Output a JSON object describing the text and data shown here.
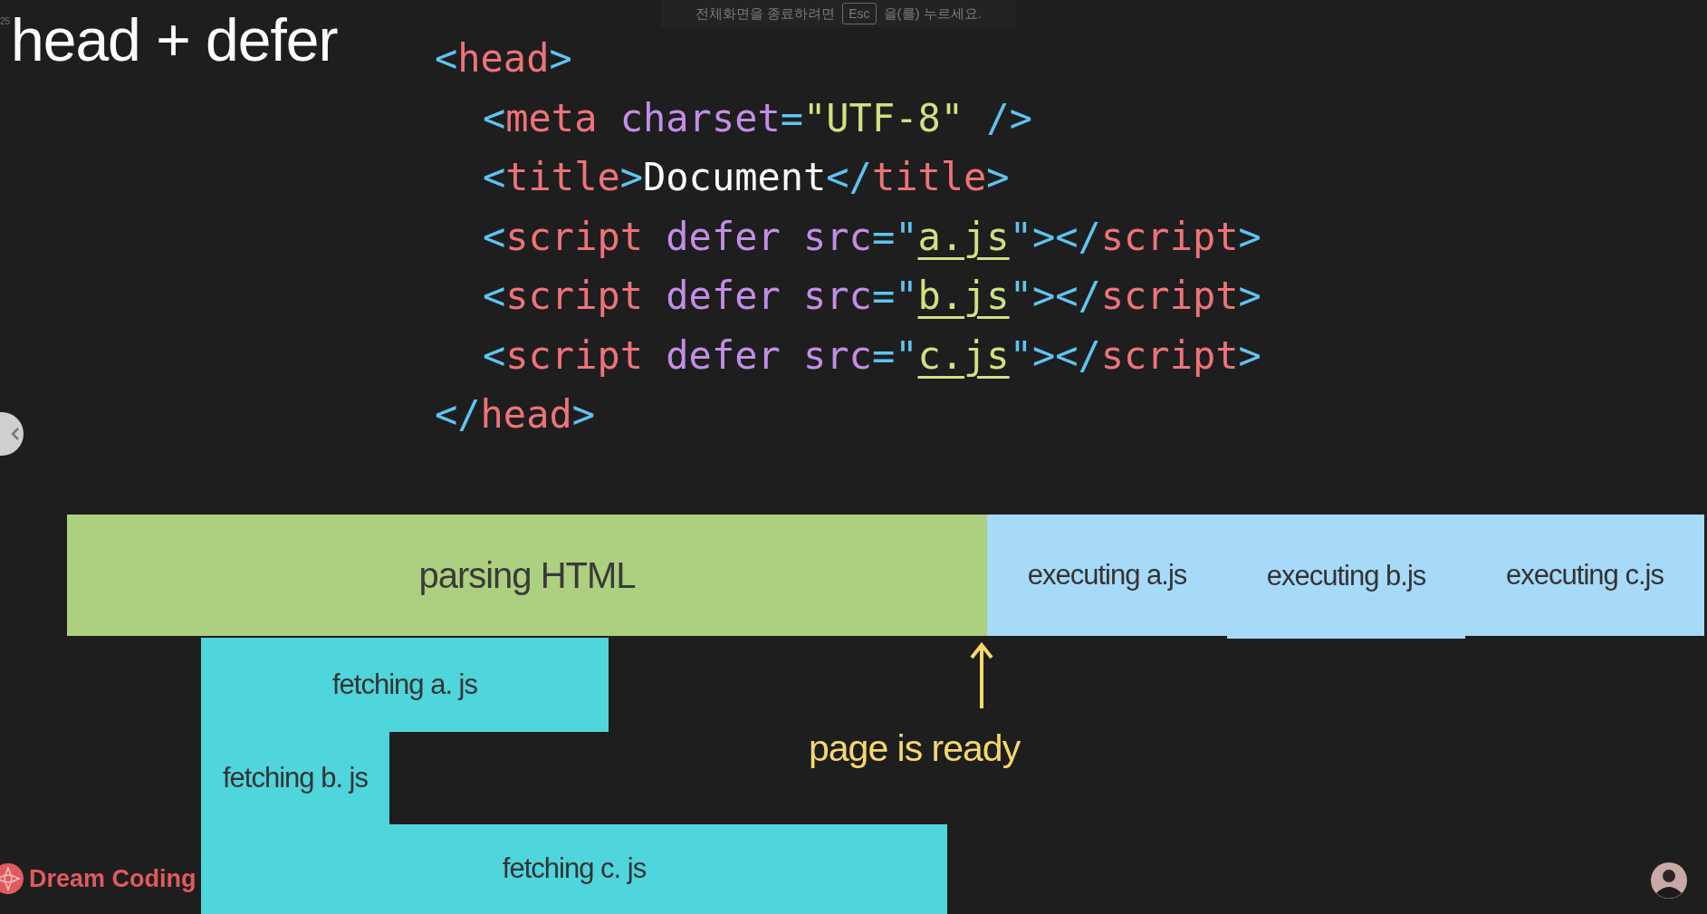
{
  "notice": {
    "before": "전체화면을 종료하려면",
    "key": "Esc",
    "after": "을(를) 누르세요."
  },
  "slide_number": "25",
  "title": "head + defer",
  "code": [
    {
      "indent": false,
      "tokens": [
        {
          "kind": "punct",
          "text": "<"
        },
        {
          "kind": "tag",
          "text": "head"
        },
        {
          "kind": "punct",
          "text": ">"
        }
      ]
    },
    {
      "indent": true,
      "tokens": [
        {
          "kind": "punct",
          "text": "<"
        },
        {
          "kind": "tag",
          "text": "meta "
        },
        {
          "kind": "attr",
          "text": "charset"
        },
        {
          "kind": "punct",
          "text": "="
        },
        {
          "kind": "str",
          "text": "\"UTF-8\" "
        },
        {
          "kind": "punct",
          "text": "/>"
        }
      ]
    },
    {
      "indent": true,
      "tokens": [
        {
          "kind": "punct",
          "text": "<"
        },
        {
          "kind": "tag",
          "text": "title"
        },
        {
          "kind": "punct",
          "text": ">"
        },
        {
          "kind": "text",
          "text": "Document"
        },
        {
          "kind": "punct",
          "text": "</"
        },
        {
          "kind": "tag",
          "text": "title"
        },
        {
          "kind": "punct",
          "text": ">"
        }
      ]
    },
    {
      "indent": true,
      "tokens": [
        {
          "kind": "punct",
          "text": "<"
        },
        {
          "kind": "tag",
          "text": "script "
        },
        {
          "kind": "attr",
          "text": "defer src"
        },
        {
          "kind": "punct",
          "text": "=\""
        },
        {
          "kind": "path",
          "text": "a.js"
        },
        {
          "kind": "punct",
          "text": "\"></"
        },
        {
          "kind": "tag",
          "text": "script"
        },
        {
          "kind": "punct",
          "text": ">"
        }
      ]
    },
    {
      "indent": true,
      "tokens": [
        {
          "kind": "punct",
          "text": "<"
        },
        {
          "kind": "tag",
          "text": "script "
        },
        {
          "kind": "attr",
          "text": "defer src"
        },
        {
          "kind": "punct",
          "text": "=\""
        },
        {
          "kind": "path",
          "text": "b.js"
        },
        {
          "kind": "punct",
          "text": "\"></"
        },
        {
          "kind": "tag",
          "text": "script"
        },
        {
          "kind": "punct",
          "text": ">"
        }
      ]
    },
    {
      "indent": true,
      "tokens": [
        {
          "kind": "punct",
          "text": "<"
        },
        {
          "kind": "tag",
          "text": "script "
        },
        {
          "kind": "attr",
          "text": "defer src"
        },
        {
          "kind": "punct",
          "text": "=\""
        },
        {
          "kind": "path",
          "text": "c.js"
        },
        {
          "kind": "punct",
          "text": "\"></"
        },
        {
          "kind": "tag",
          "text": "script"
        },
        {
          "kind": "punct",
          "text": ">"
        }
      ]
    },
    {
      "indent": false,
      "tokens": [
        {
          "kind": "punct",
          "text": "</"
        },
        {
          "kind": "tag",
          "text": "head"
        },
        {
          "kind": "punct",
          "text": ">"
        }
      ]
    }
  ],
  "timeline": {
    "main": [
      {
        "kind": "parse",
        "label": "parsing HTML"
      },
      {
        "kind": "execute",
        "label": "executing a.js"
      },
      {
        "kind": "execute",
        "label": "executing b.js"
      },
      {
        "kind": "execute",
        "label": "executing c.js"
      }
    ],
    "fetches": [
      {
        "label": "fetching a. js"
      },
      {
        "label": "fetching b. js"
      },
      {
        "label": "fetching c. js"
      }
    ],
    "marker": {
      "label": "page is ready"
    }
  },
  "logo": {
    "text": "Dream Coding"
  }
}
